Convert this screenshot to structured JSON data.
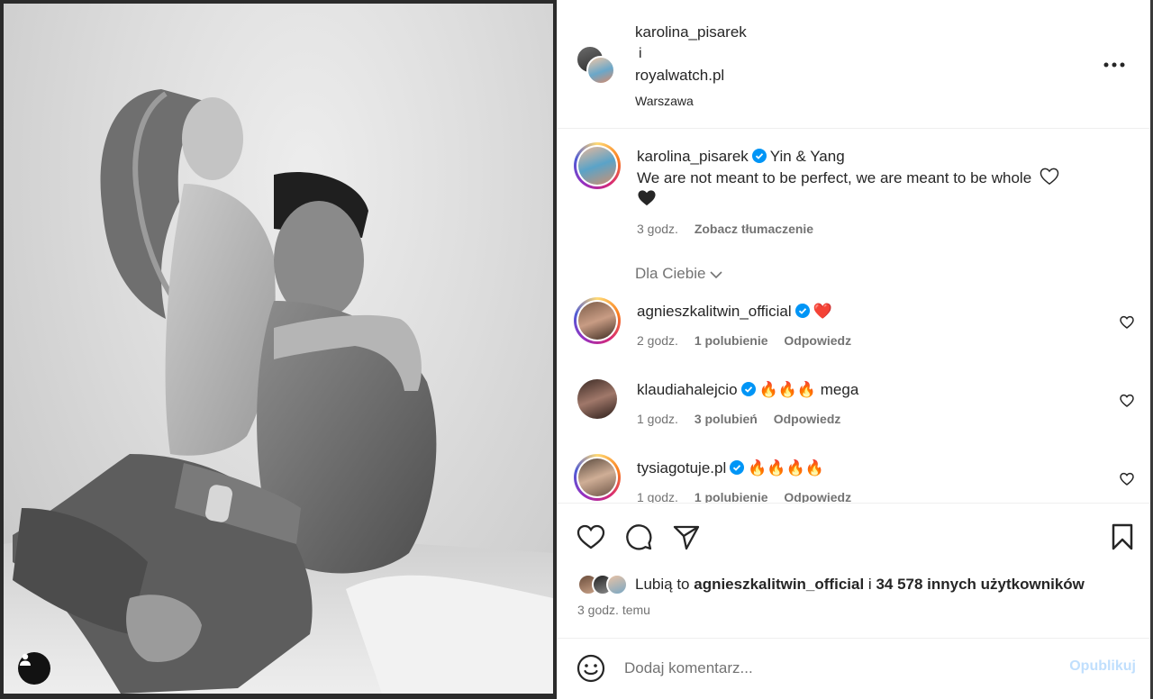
{
  "post": {
    "authors": [
      "karolina_pisarek",
      "royalwatch.pl"
    ],
    "and_word": "i",
    "location": "Warszawa",
    "more_icon": "more-horizontal-icon",
    "caption": {
      "username": "karolina_pisarek",
      "title": "Yin & Yang",
      "text": "We are not meant to be perfect, we are meant to be whole",
      "time": "3 godz.",
      "translate": "Zobacz tłumaczenie"
    },
    "for_you": "Dla Ciebie",
    "comments": [
      {
        "username": "agnieszkalitwin_official",
        "text": "❤️",
        "time": "2 godz.",
        "likes": "1 polubienie",
        "reply": "Odpowiedz"
      },
      {
        "username": "klaudiahalejcio",
        "text": "🔥🔥🔥 mega",
        "time": "1 godz.",
        "likes": "3 polubień",
        "reply": "Odpowiedz"
      },
      {
        "username": "tysiagotuje.pl",
        "text": "🔥🔥🔥🔥",
        "time": "1 godz.",
        "likes": "1 polubienie",
        "reply": "Odpowiedz"
      }
    ],
    "likes": {
      "prefix": "Lubią to",
      "user": "agnieszkalitwin_official",
      "middle": "i",
      "rest": "34 578 innych użytkowników"
    },
    "time_ago": "3 godz. temu",
    "comment_placeholder": "Dodaj komentarz...",
    "publish_label": "Opublikuj"
  },
  "colors": {
    "verified": "#0095f6",
    "heart_red": "#ed1c24",
    "muted": "#737373",
    "publish_disabled": "#c0dffd"
  }
}
